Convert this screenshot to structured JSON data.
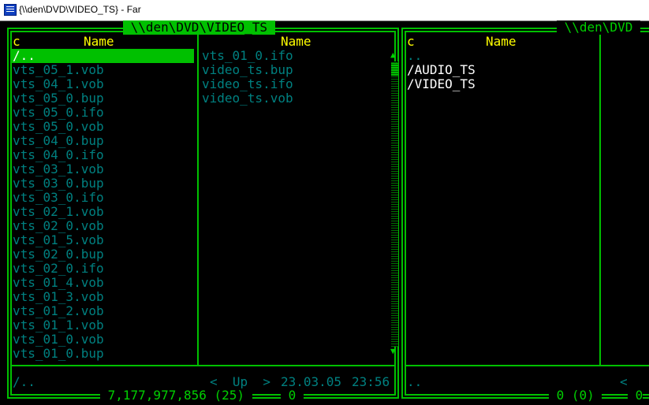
{
  "window": {
    "title": "{\\\\den\\DVD\\VIDEO_TS} - Far"
  },
  "colors": {
    "border": "#00c000",
    "text_file": "#008080",
    "header": "#ffff00",
    "selection_bg": "#00c000",
    "dir_text": "#ffffff"
  },
  "left_panel": {
    "path": " \\\\den\\DVD\\VIDEO_TS ",
    "col1": {
      "sort_letter": "c",
      "header": "Name"
    },
    "col2": {
      "header": "Name"
    },
    "col1_items": [
      "/..",
      "vts_05_1.vob",
      "vts_04_1.vob",
      "vts_05_0.bup",
      "vts_05_0.ifo",
      "vts_05_0.vob",
      "vts_04_0.bup",
      "vts_04_0.ifo",
      "vts_03_1.vob",
      "vts_03_0.bup",
      "vts_03_0.ifo",
      "vts_02_1.vob",
      "vts_02_0.vob",
      "vts_01_5.vob",
      "vts_02_0.bup",
      "vts_02_0.ifo",
      "vts_01_4.vob",
      "vts_01_3.vob",
      "vts_01_2.vob",
      "vts_01_1.vob",
      "vts_01_0.vob",
      "vts_01_0.bup"
    ],
    "col2_items": [
      "vts_01_0.ifo",
      "video_ts.bup",
      "video_ts.ifo",
      "video_ts.vob"
    ],
    "selected_index": 0,
    "status": {
      "name": "/..",
      "size": "<  Up  >",
      "date": "23.03.05",
      "time": "23:56"
    },
    "footer": {
      "total": " 7,177,977,856 (25) ",
      "selected": " 0 "
    },
    "scrollbar": {
      "up_icon": "▲",
      "down_icon": "▼",
      "position_fraction": 0.0
    }
  },
  "right_panel": {
    "path": " \\\\den\\DVD ",
    "col1": {
      "sort_letter": "c",
      "header": "Name"
    },
    "col1_items": [
      "..",
      "/AUDIO_TS",
      "/VIDEO_TS"
    ],
    "status": {
      "name": "..",
      "tail": "<"
    },
    "footer": {
      "total": " 0 (0) ",
      "selected": " 0"
    }
  }
}
